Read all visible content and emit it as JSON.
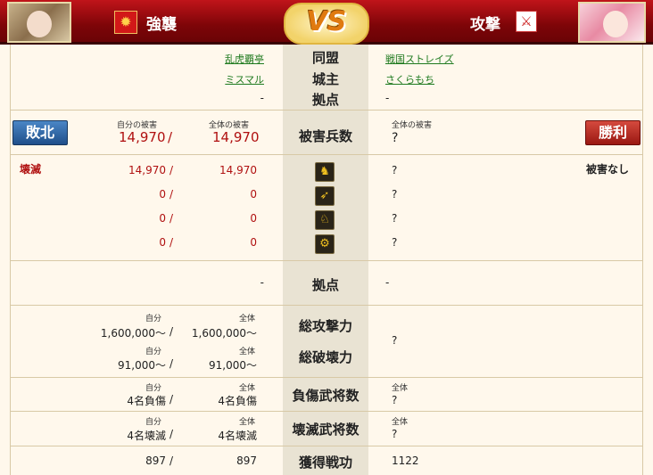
{
  "header": {
    "mode_label": "強襲",
    "vs": "VS",
    "attack_label": "攻撃"
  },
  "info": {
    "alliance_label": "同盟",
    "lord_label": "城主",
    "base_label": "拠点",
    "left_alliance": "乱虎覇亭",
    "left_lord": "ミスマル",
    "left_base": "-",
    "right_alliance": "戦国ストレイズ",
    "right_lord": "さくらもち",
    "right_base": "-"
  },
  "casualties": {
    "defeat_label": "敗北",
    "victory_label": "勝利",
    "own_loss_label": "自分の被害",
    "total_loss_label": "全体の被害",
    "right_total_loss_label": "全体の被害",
    "center_label": "被害兵数",
    "own_value": "14,970",
    "slash": "/",
    "total_value": "14,970",
    "right_value": "?"
  },
  "units": {
    "destroyed_label": "壊滅",
    "no_damage_label": "被害なし",
    "rows": [
      {
        "own": "14,970",
        "total": "14,970",
        "right": "?",
        "icon": "spearman-icon"
      },
      {
        "own": "0",
        "total": "0",
        "right": "?",
        "icon": "archer-icon"
      },
      {
        "own": "0",
        "total": "0",
        "right": "?",
        "icon": "cavalry-icon"
      },
      {
        "own": "0",
        "total": "0",
        "right": "?",
        "icon": "siege-icon"
      }
    ]
  },
  "base_row": {
    "label": "拠点",
    "left": "-",
    "right": "-"
  },
  "power": {
    "self_label": "自分",
    "total_label": "全体",
    "attack_label": "総攻撃力",
    "attack_own": "1,600,000～",
    "attack_total": "1,600,000～",
    "destroy_label": "総破壊力",
    "destroy_own": "91,000～",
    "destroy_total": "91,000～",
    "right": "?"
  },
  "wounded": {
    "label": "負傷武将数",
    "self_label": "自分",
    "total_label": "全体",
    "own": "4名負傷",
    "total": "4名負傷",
    "right_total_label": "全体",
    "right": "?"
  },
  "killed": {
    "label": "壊滅武将数",
    "self_label": "自分",
    "total_label": "全体",
    "own": "4名壊滅",
    "total": "4名壊滅",
    "right_total_label": "全体",
    "right": "?"
  },
  "merit": {
    "label": "獲得戦功",
    "own": "897",
    "total": "897",
    "right": "1122"
  },
  "colors": {
    "header_red": "#7e0508",
    "center_column": "#e9e3d3",
    "link_green": "#1f7a1f",
    "loss_red": "#b01010",
    "defeat_blue": "#1f4f8a",
    "victory_red": "#9a1812"
  }
}
